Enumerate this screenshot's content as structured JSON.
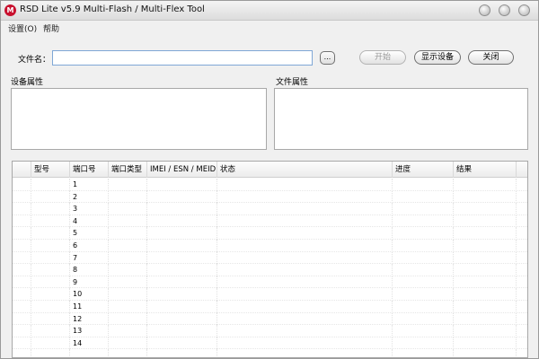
{
  "window": {
    "title": "RSD Lite v5.9 Multi-Flash / Multi-Flex Tool",
    "logo_glyph": "M",
    "icons": {
      "app": "motorola-logo-icon",
      "minimize": "minimize-icon",
      "maximize": "maximize-icon",
      "close": "close-icon"
    }
  },
  "menu": {
    "items": [
      "设置(O)",
      "帮助"
    ]
  },
  "toolbar": {
    "file_label": "文件名：",
    "file_value": "",
    "browse_label": "...",
    "start_label": "开始",
    "start_enabled": false,
    "show_devices_label": "显示设备",
    "close_label": "关闭"
  },
  "panels": {
    "device_properties_label": "设备属性",
    "file_properties_label": "文件属性"
  },
  "table": {
    "columns": [
      "",
      "型号",
      "端口号",
      "端口类型",
      "IMEI / ESN / MEID",
      "状态",
      "进度",
      "结果",
      ""
    ],
    "rows": [
      {
        "port": "1"
      },
      {
        "port": "2"
      },
      {
        "port": "3"
      },
      {
        "port": "4"
      },
      {
        "port": "5"
      },
      {
        "port": "6"
      },
      {
        "port": "7"
      },
      {
        "port": "8"
      },
      {
        "port": "9"
      },
      {
        "port": "10"
      },
      {
        "port": "11"
      },
      {
        "port": "12"
      },
      {
        "port": "13"
      },
      {
        "port": "14"
      },
      {
        "port": ""
      }
    ]
  },
  "colors": {
    "logo": "#c8102e",
    "input_border": "#7fa7d6",
    "disabled_text": "#9a9a9a"
  }
}
